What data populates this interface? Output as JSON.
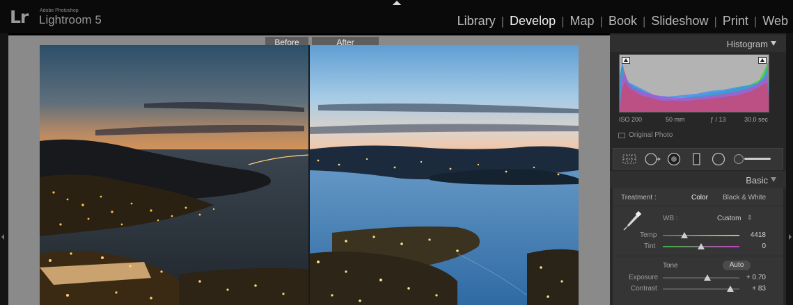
{
  "app": {
    "maker": "Adobe Photoshop",
    "name": "Lightroom 5",
    "logo_letters": "Lr"
  },
  "modules": [
    "Library",
    "Develop",
    "Map",
    "Book",
    "Slideshow",
    "Print",
    "Web"
  ],
  "active_module": "Develop",
  "view": {
    "before_label": "Before",
    "after_label": "After"
  },
  "histogram": {
    "title": "Histogram",
    "iso": "ISO 200",
    "focal_length": "50 mm",
    "aperture": "ƒ / 13",
    "shutter": "30.0 sec",
    "original_photo_label": "Original Photo"
  },
  "tools": [
    "crop-overlay",
    "spot-removal",
    "red-eye",
    "graduated-filter",
    "radial-filter",
    "adjustment-brush"
  ],
  "basic": {
    "title": "Basic",
    "treatment_label": "Treatment :",
    "treatment_color": "Color",
    "treatment_bw": "Black & White",
    "wb_label": "WB :",
    "wb_value": "Custom",
    "temp_label": "Temp",
    "temp_value": "4418",
    "tint_label": "Tint",
    "tint_value": "0",
    "tone_label": "Tone",
    "auto_label": "Auto",
    "exposure_label": "Exposure",
    "exposure_value": "+ 0.70",
    "contrast_label": "Contrast",
    "contrast_value": "+ 83"
  },
  "colors": {
    "background": "#000000",
    "canvas": "#8a8a8a",
    "panel": "#272727",
    "panel_section": "#353535",
    "active_text": "#f2f2f2"
  }
}
